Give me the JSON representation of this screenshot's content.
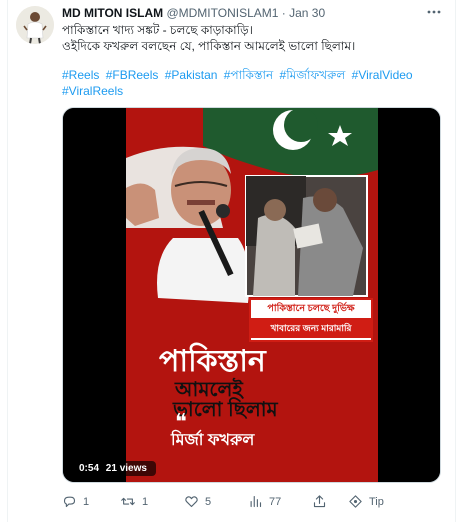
{
  "tweet": {
    "author_name": "MD MITON ISLAM",
    "author_handle": "@MDMITONISLAM1",
    "separator": "·",
    "date": "Jan 30",
    "text_line1": "পাকিস্তানে খাদ্য সঙ্কট - চলছে কাড়াকাড়ি।",
    "text_line2": "ওইদিকে ফখরুল বলছেন যে, পাকিস্তান আমলেই ভালো ছিলাম।",
    "hashtags": [
      "#Reels",
      "#FBReels",
      "#Pakistan",
      "#পাকিস্তান",
      "#মির্জাফখরুল",
      "#ViralVideo",
      "#ViralReels"
    ]
  },
  "video": {
    "caption_line1": "পাকিস্তানে চলছে দুর্ভিক্ষ",
    "caption_line2": "খাবারের জন্য মারামারি",
    "title_line1": "পাকিস্তান",
    "title_line2": "আমলেই",
    "title_line3": "ভালো ছিলাম",
    "quote_mark": "❝",
    "speaker": "মির্জা ফখরুল",
    "duration": "0:54",
    "views": "21 views"
  },
  "actions": {
    "replies": "1",
    "retweets": "1",
    "likes": "5",
    "views": "77",
    "tip_label": "Tip"
  },
  "colors": {
    "link": "#1d9bf0",
    "muted": "#536471",
    "video_red": "#b3140f",
    "pakistan_green": "#1f5a2e"
  },
  "icons": [
    "more-icon",
    "reply-icon",
    "retweet-icon",
    "like-icon",
    "views-icon",
    "share-icon",
    "tip-icon"
  ]
}
